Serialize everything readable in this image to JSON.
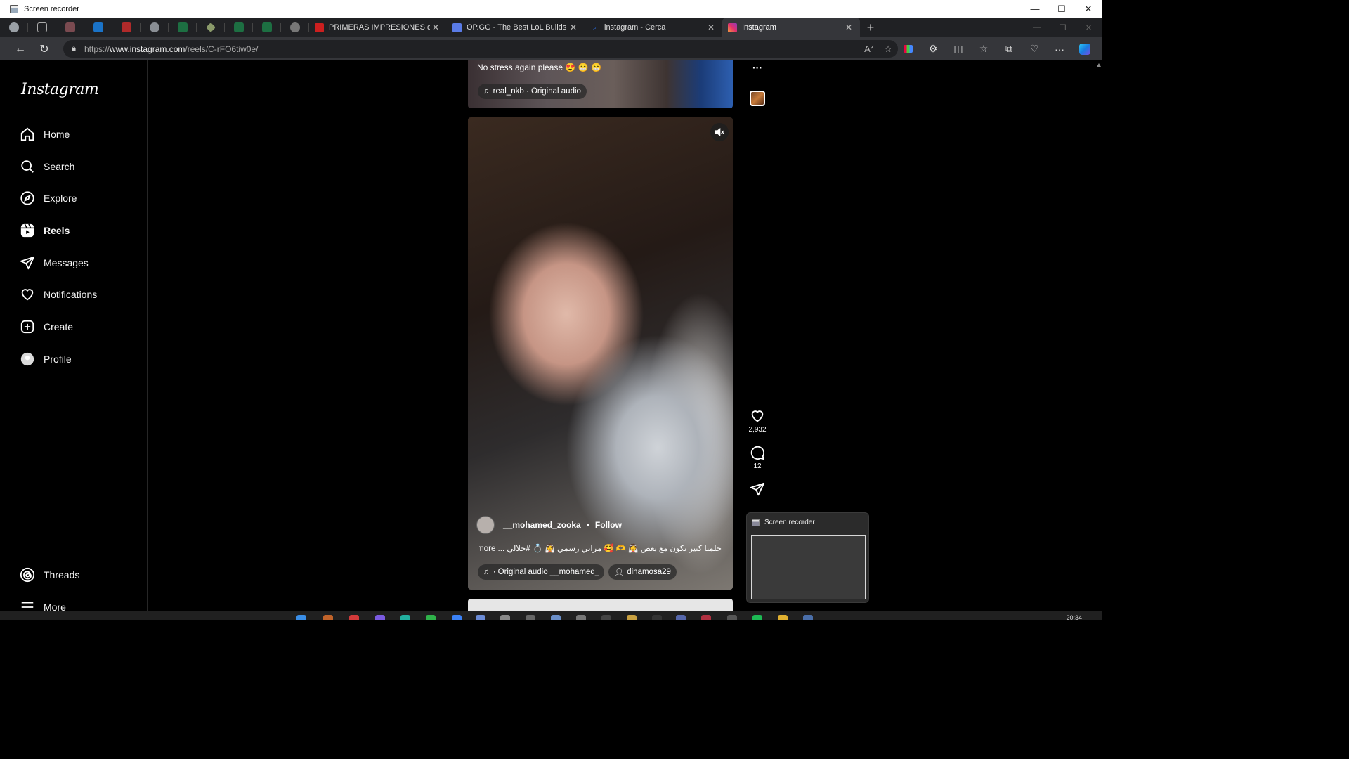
{
  "window": {
    "title": "Screen recorder",
    "minimize": "—",
    "maximize": "☐",
    "close": "✕"
  },
  "browser": {
    "tabs": [
      {
        "title": "PRIMERAS IMPRESIONES de K",
        "favicon_color": "#cc1f1f"
      },
      {
        "title": "OP.GG - The Best LoL Builds and",
        "favicon_color": "#5a7be6"
      },
      {
        "title": "instagram - Cerca",
        "favicon_color": "#2b6de3"
      },
      {
        "title": "Instagram",
        "favicon_color": "#e1306c"
      }
    ],
    "pinned_tab_icons": [
      "profile-icon",
      "workspaces-icon",
      "tab-icon",
      "outlook-icon",
      "tab-icon",
      "check-icon",
      "excel-icon",
      "diamond-icon",
      "excel-icon",
      "excel-icon",
      "chatgpt-icon"
    ],
    "url_prefix": "https://",
    "url_host": "www.instagram.com",
    "url_path": "/reels/C-rFO6tiw0e/",
    "new_tab": "+",
    "tab_close": "✕",
    "nav_back": "←",
    "nav_reload": "↻"
  },
  "instagram": {
    "logo": "Instagram",
    "nav": [
      {
        "label": "Home",
        "icon": "home-icon"
      },
      {
        "label": "Search",
        "icon": "search-icon"
      },
      {
        "label": "Explore",
        "icon": "explore-icon"
      },
      {
        "label": "Reels",
        "icon": "reels-icon",
        "active": true
      },
      {
        "label": "Messages",
        "icon": "messages-icon"
      },
      {
        "label": "Notifications",
        "icon": "heart-icon"
      },
      {
        "label": "Create",
        "icon": "create-icon"
      },
      {
        "label": "Profile",
        "icon": "profile-icon"
      }
    ],
    "bottom_nav": [
      {
        "label": "Threads",
        "icon": "threads-icon"
      },
      {
        "label": "More",
        "icon": "menu-icon"
      }
    ],
    "prev_reel": {
      "caption": "No stress again please 😍 😁 😁",
      "audio": "real_nkb · Original audio"
    },
    "reel": {
      "username": "__mohamed_zooka",
      "separator": "•",
      "follow": "Follow",
      "caption": "حلمنا كتير نكون مع بعض 👰 🫶 🥰 مراتي رسمي 👰 💍 #حلالي ... more",
      "audio_chip": "· Original audio  __mohamed_zooka",
      "tagged_user": "dinamosa29"
    },
    "actions": {
      "more": "···",
      "likes": "2,932",
      "comments": "12"
    }
  },
  "recorder_popup": {
    "title": "Screen recorder"
  },
  "taskbar": {
    "clock": "20:34"
  }
}
